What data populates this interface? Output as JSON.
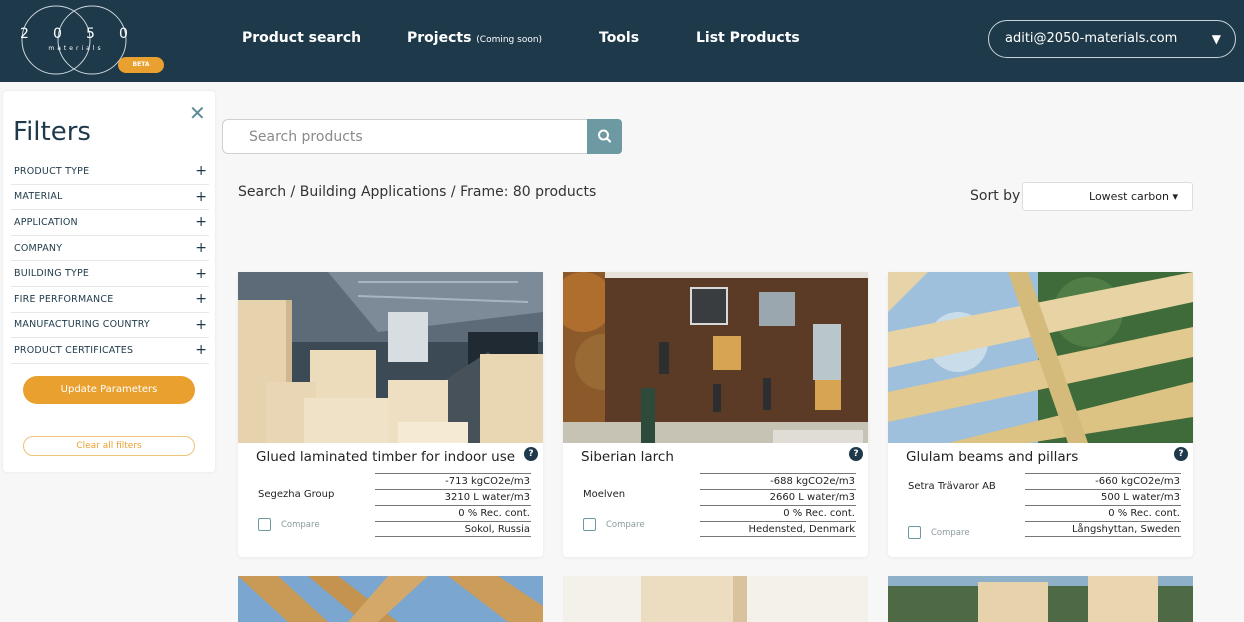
{
  "header": {
    "logo": {
      "digits": [
        "2",
        "0",
        "5",
        "0"
      ],
      "sub": "materials",
      "badge": "BETA"
    },
    "nav": [
      {
        "label": "Product search",
        "suffix": ""
      },
      {
        "label": "Projects",
        "suffix": "(Coming soon)"
      },
      {
        "label": "Tools",
        "suffix": ""
      },
      {
        "label": "List Products",
        "suffix": ""
      }
    ],
    "user_email": "aditi@2050-materials.com",
    "caret_icon": "caret-down-icon"
  },
  "filters": {
    "title": "Filters",
    "close_icon": "close-icon",
    "items": [
      {
        "label": "PRODUCT TYPE"
      },
      {
        "label": "MATERIAL"
      },
      {
        "label": "APPLICATION"
      },
      {
        "label": "COMPANY"
      },
      {
        "label": "BUILDING TYPE"
      },
      {
        "label": "FIRE PERFORMANCE"
      },
      {
        "label": "MANUFACTURING COUNTRY"
      },
      {
        "label": "PRODUCT CERTIFICATES"
      }
    ],
    "update_label": "Update Parameters",
    "clear_label": "Clear all filters"
  },
  "search": {
    "placeholder": "Search products",
    "button_icon": "search-icon",
    "breadcrumb": "Search / Building Applications / Frame: 80 products"
  },
  "sort": {
    "label": "Sort by",
    "value": "Lowest carbon ▾"
  },
  "products": [
    {
      "title": "Glued laminated timber for indoor use",
      "company": "Segezha Group",
      "carbon": "-713 kgCO2e/m3",
      "water": "3210 L water/m3",
      "recycled": "0 % Rec. cont.",
      "location": "Sokol, Russia",
      "compare_label": "Compare"
    },
    {
      "title": "Siberian larch",
      "company": "Moelven",
      "carbon": "-688 kgCO2e/m3",
      "water": "2660 L water/m3",
      "recycled": "0 % Rec. cont.",
      "location": "Hedensted, Denmark",
      "compare_label": "Compare"
    },
    {
      "title": "Glulam beams and pillars",
      "company": "Setra Trävaror AB",
      "carbon": "-660 kgCO2e/m3",
      "water": "500 L water/m3",
      "recycled": "0 % Rec. cont.",
      "location": "Långshyttan, Sweden",
      "compare_label": "Compare"
    }
  ],
  "help_icon": "?",
  "colors": {
    "header_bg": "#1e3a4a",
    "accent": "#e9a02e",
    "search_button": "#6d9aa2"
  }
}
